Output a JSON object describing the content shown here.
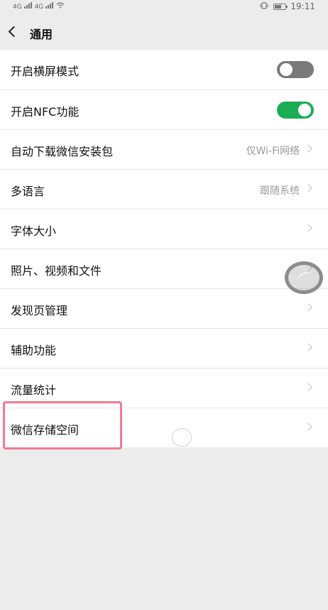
{
  "status_bar": {
    "time": "19:11",
    "signal1_label": "4G",
    "signal2_label": "4G",
    "battery_level": 0.62
  },
  "nav": {
    "title": "通用"
  },
  "settings": [
    {
      "label": "开启横屏模式",
      "value": "",
      "control": "toggle",
      "toggle_state": "off"
    },
    {
      "label": "开启NFC功能",
      "value": "",
      "control": "toggle",
      "toggle_state": "on"
    },
    {
      "label": "自动下载微信安装包",
      "value": "仅Wi-Fi网络",
      "control": "chevron"
    },
    {
      "label": "多语言",
      "value": "跟随系统",
      "control": "chevron"
    },
    {
      "label": "字体大小",
      "value": "",
      "control": "chevron"
    },
    {
      "label": "照片、视频和文件",
      "value": "",
      "control": "chevron"
    },
    {
      "label": "发现页管理",
      "value": "",
      "control": "chevron"
    },
    {
      "label": "辅助功能",
      "value": "",
      "control": "chevron"
    },
    {
      "label": "流量统计",
      "value": "",
      "control": "chevron"
    },
    {
      "label": "微信存储空间",
      "value": "",
      "control": "chevron"
    }
  ],
  "colors": {
    "toggle_on": "#1aad56",
    "toggle_off": "#7a7a7a",
    "highlight": "#f27a93",
    "background": "#ececec"
  }
}
